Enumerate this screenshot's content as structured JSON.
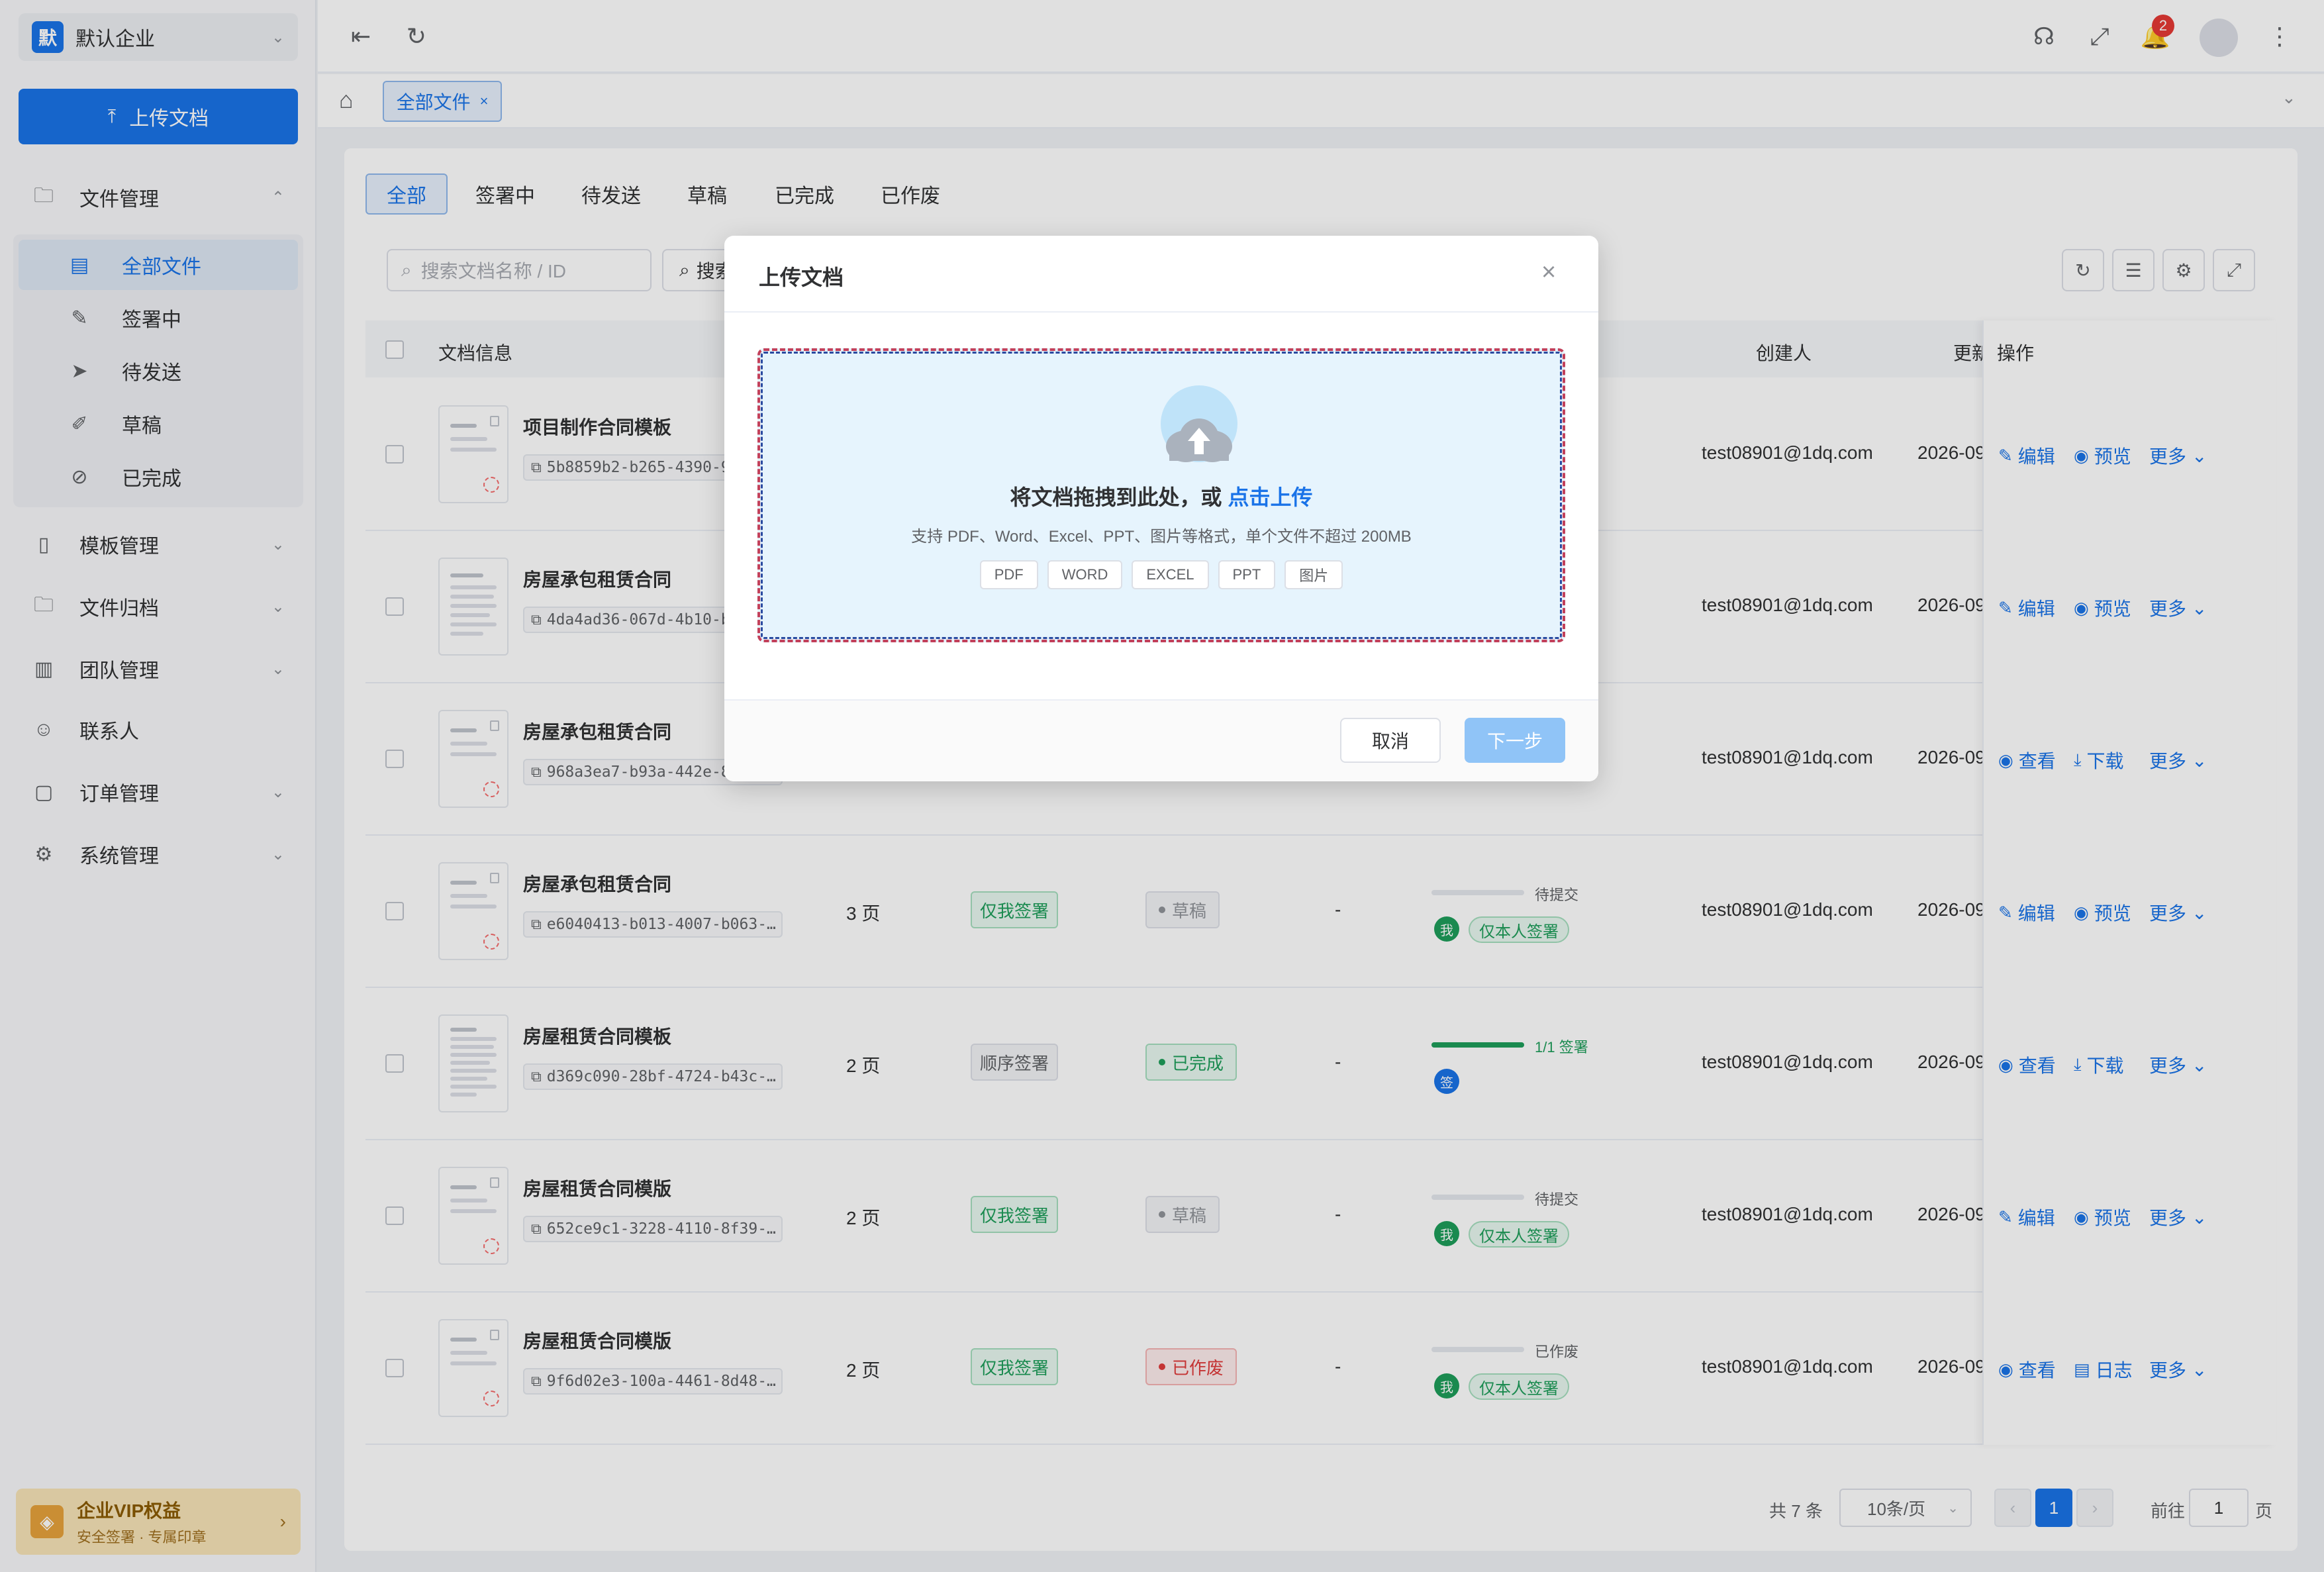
{
  "sidebar": {
    "company_initial": "默",
    "company_name": "默认企业",
    "upload_label": "上传文档",
    "file_mgmt": "文件管理",
    "sub": [
      "全部文件",
      "签署中",
      "待发送",
      "草稿",
      "已完成"
    ],
    "groups": [
      "模板管理",
      "文件归档",
      "团队管理",
      "联系人",
      "订单管理",
      "系统管理"
    ],
    "vip_title": "企业VIP权益",
    "vip_sub": "安全签署 · 专属印章"
  },
  "topbar": {
    "notif_count": "2"
  },
  "page_tab": {
    "label": "全部文件",
    "close": "×"
  },
  "filters": [
    "全部",
    "签署中",
    "待发送",
    "草稿",
    "已完成",
    "已作废"
  ],
  "search": {
    "placeholder": "搜索文档名称 / ID",
    "button": "搜索"
  },
  "table": {
    "headers": {
      "doc": "文档信息",
      "creator": "创建人",
      "updated": "更新",
      "ops": "操作"
    },
    "rows": [
      {
        "name": "项目制作合同模板",
        "id": "5b8859b2-b265-4390-9…",
        "pages": "",
        "mode": "",
        "status": "",
        "dash": "",
        "progress": "",
        "creator": "test08901@1dq.com",
        "updated": "2026-09-",
        "ops": [
          "编辑",
          "预览",
          "更多"
        ]
      },
      {
        "name": "房屋承包租赁合同",
        "id": "4da4ad36-067d-4b10-b…",
        "pages": "",
        "mode": "",
        "status": "",
        "dash": "",
        "progress": "",
        "creator": "test08901@1dq.com",
        "updated": "2026-09-",
        "ops": [
          "编辑",
          "预览",
          "更多"
        ]
      },
      {
        "name": "房屋承包租赁合同",
        "id": "968a3ea7-b93a-442e-8…",
        "pages": "",
        "mode": "",
        "status": "",
        "dash": "",
        "progress": "",
        "creator": "test08901@1dq.com",
        "updated": "2026-09-",
        "ops": [
          "查看",
          "下载",
          "更多"
        ]
      },
      {
        "name": "房屋承包租赁合同",
        "id": "e6040413-b013-4007-b063-…",
        "pages": "3 页",
        "mode": "仅我签署",
        "status": "草稿",
        "dash": "-",
        "progress": "待提交",
        "me": "我",
        "self": "仅本人签署",
        "creator": "test08901@1dq.com",
        "updated": "2026-09-",
        "ops": [
          "编辑",
          "预览",
          "更多"
        ]
      },
      {
        "name": "房屋租赁合同模板",
        "id": "d369c090-28bf-4724-b43c-…",
        "pages": "2 页",
        "mode": "顺序签署",
        "status": "已完成",
        "dash": "-",
        "progress": "1/1 签署",
        "me": "签",
        "creator": "test08901@1dq.com",
        "updated": "2026-09-",
        "ops": [
          "查看",
          "下载",
          "更多"
        ]
      },
      {
        "name": "房屋租赁合同模版",
        "id": "652ce9c1-3228-4110-8f39-…",
        "pages": "2 页",
        "mode": "仅我签署",
        "status": "草稿",
        "dash": "-",
        "progress": "待提交",
        "me": "我",
        "self": "仅本人签署",
        "creator": "test08901@1dq.com",
        "updated": "2026-09-",
        "ops": [
          "编辑",
          "预览",
          "更多"
        ]
      },
      {
        "name": "房屋租赁合同模版",
        "id": "9f6d02e3-100a-4461-8d48-…",
        "pages": "2 页",
        "mode": "仅我签署",
        "status": "已作废",
        "dash": "-",
        "progress": "已作废",
        "me": "我",
        "self": "仅本人签署",
        "creator": "test08901@1dq.com",
        "updated": "2026-09-",
        "ops": [
          "查看",
          "日志",
          "更多"
        ]
      }
    ]
  },
  "progress_fill": {
    "row5": 1.0
  },
  "pager": {
    "total": "共 7 条",
    "size": "10条/页",
    "current": "1",
    "goto": "前往",
    "goto_value": "1",
    "page_unit": "页"
  },
  "modal": {
    "title": "上传文档",
    "drop_text": "将文档拖拽到此处，或",
    "drop_link": "点击上传",
    "drop_hint": "支持 PDF、Word、Excel、PPT、图片等格式，单个文件不超过 200MB",
    "formats": [
      "PDF",
      "WORD",
      "EXCEL",
      "PPT",
      "图片"
    ],
    "cancel": "取消",
    "next": "下一步"
  },
  "colors": {
    "primary": "#1a73e8",
    "success": "#1e9e5a",
    "danger": "#e03c3c",
    "vip": "#e6a23c"
  }
}
